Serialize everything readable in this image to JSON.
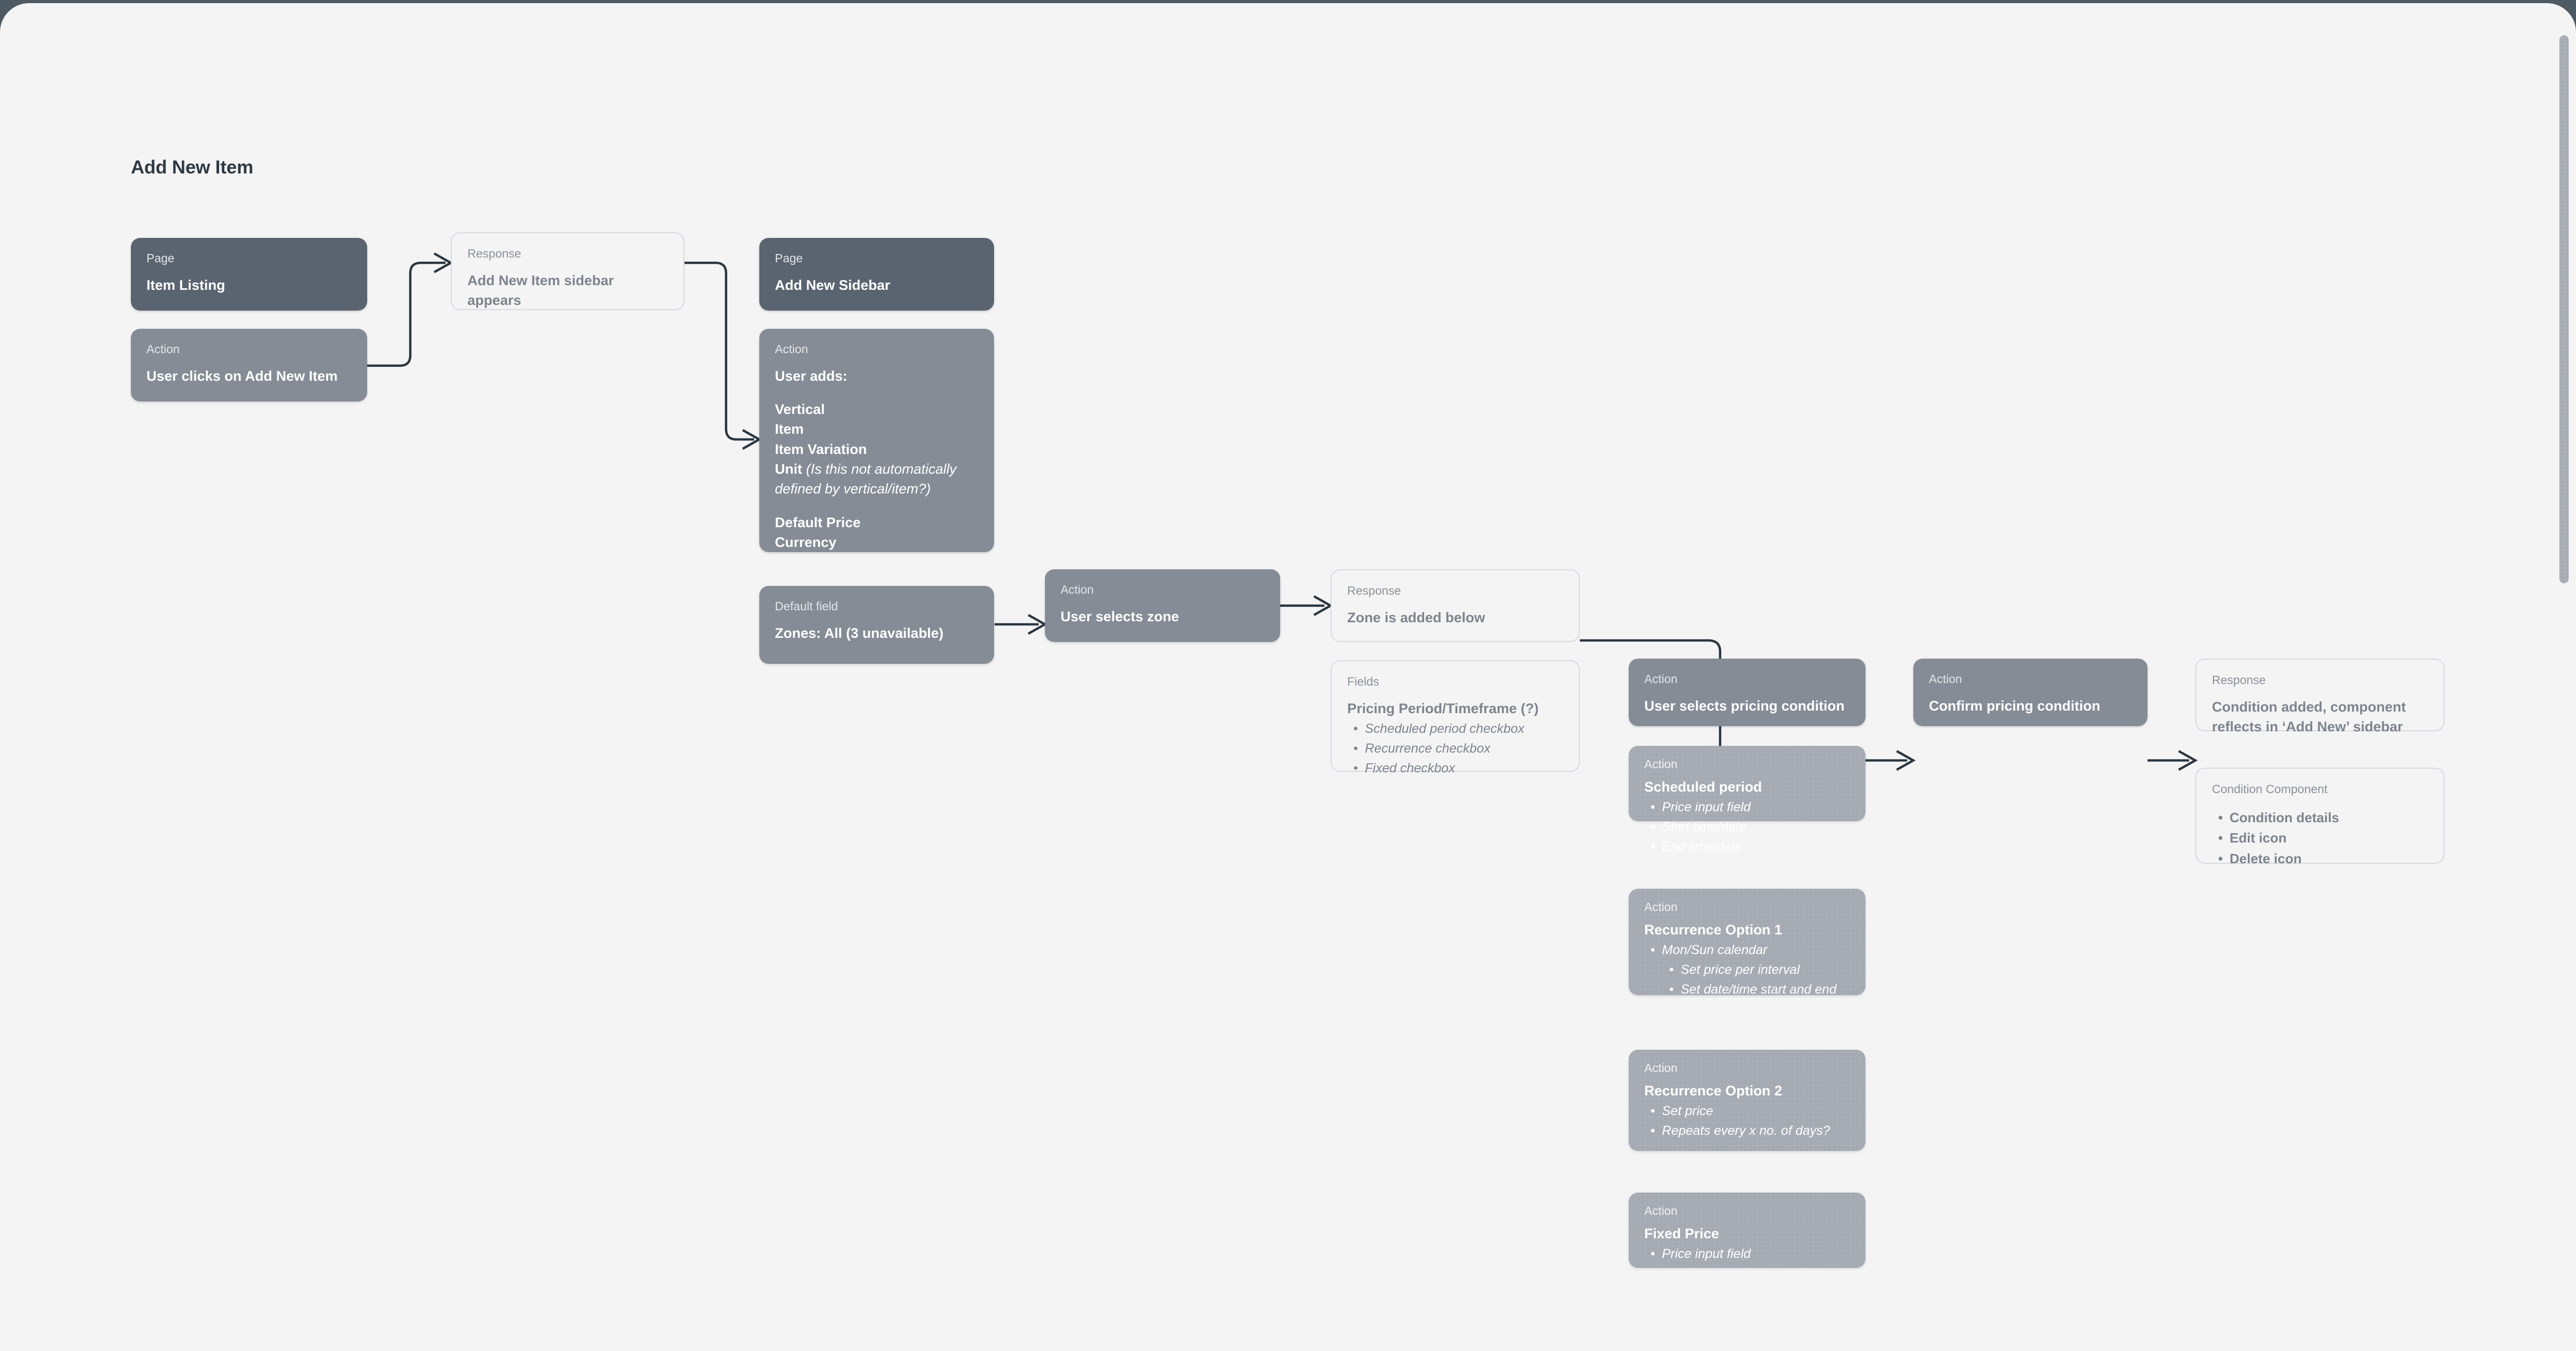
{
  "flow": {
    "title": "Add New Item"
  },
  "labels": {
    "page": "Page",
    "action": "Action",
    "response": "Response",
    "fields": "Fields",
    "default_field": "Default field",
    "condition_component": "Condition Component"
  },
  "nodes": {
    "item_listing": {
      "kicker": "Page",
      "title": "Item Listing"
    },
    "user_clicks_add_new_item": {
      "kicker": "Action",
      "title": "User clicks on Add New Item"
    },
    "sidebar_appears": {
      "kicker": "Response",
      "title": "Add New Item sidebar appears"
    },
    "add_new_sidebar": {
      "kicker": "Page",
      "title": "Add New Sidebar"
    },
    "user_adds": {
      "kicker": "Action",
      "title": "User adds:",
      "group_one": [
        "Vertical",
        "Item",
        "Item Variation"
      ],
      "unit_label": "Unit",
      "unit_note": "(Is this not automatically defined by vertical/item?)",
      "group_two": [
        "Default Price",
        "Currency"
      ]
    },
    "zones_default": {
      "kicker": "Default field",
      "title": "Zones: All (3 unavailable)"
    },
    "user_selects_zone": {
      "kicker": "Action",
      "title": "User selects zone"
    },
    "zone_added": {
      "kicker": "Response",
      "title": "Zone is added below"
    },
    "pricing_fields": {
      "kicker": "Fields",
      "title": "Pricing Period/Timeframe (?)",
      "items": [
        "Scheduled period checkbox",
        "Recurrence checkbox",
        "Fixed checkbox"
      ]
    },
    "user_selects_pricing_condition": {
      "kicker": "Action",
      "title": "User selects pricing condition"
    },
    "scheduled_period": {
      "kicker": "Action",
      "title": "Scheduled period",
      "items": [
        "Price input field",
        "Start time/date",
        "End time/date"
      ]
    },
    "recurrence_option_1": {
      "kicker": "Action",
      "title": "Recurrence Option 1",
      "items": [
        "Mon/Sun calendar"
      ],
      "subitems": [
        "Set price per interval",
        "Set date/time start and end"
      ]
    },
    "recurrence_option_2": {
      "kicker": "Action",
      "title": "Recurrence Option 2",
      "items": [
        "Set price",
        "Repeats every x no. of days?"
      ]
    },
    "fixed_price": {
      "kicker": "Action",
      "title": "Fixed Price",
      "items": [
        "Price input field"
      ]
    },
    "confirm_pricing_condition": {
      "kicker": "Action",
      "title": "Confirm pricing condition"
    },
    "condition_added": {
      "kicker": "Response",
      "title": "Condition added, component reflects in ‘Add New’ sidebar"
    },
    "condition_component": {
      "kicker": "Condition Component",
      "items": [
        "Condition details",
        "Edit icon",
        "Delete icon"
      ]
    }
  },
  "colors": {
    "canvas": "#f4f4f5",
    "page_card": "#5a6470",
    "action_card": "#858c95",
    "action_card_light": "#a6abb3",
    "outline_border": "#d8dade",
    "connector": "#2b3640",
    "title_text": "#2f3a44",
    "window_backdrop": "#4e5a63"
  }
}
